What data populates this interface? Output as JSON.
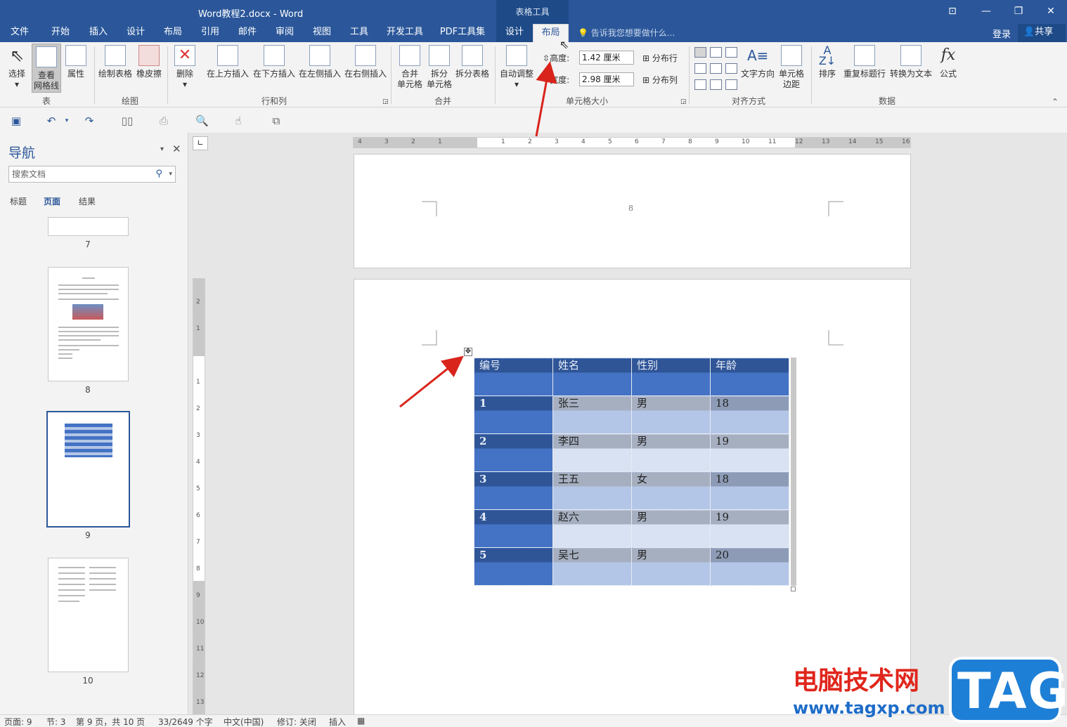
{
  "window": {
    "title": "Word教程2.docx - Word",
    "context_group": "表格工具",
    "min": "—",
    "restore": "❐",
    "close": "✕",
    "ribbon_display": "⊡"
  },
  "tabs": {
    "file": "文件",
    "home": "开始",
    "insert": "插入",
    "design": "设计",
    "layout": "布局",
    "references": "引用",
    "mailings": "邮件",
    "review": "审阅",
    "view": "视图",
    "tools": "工具",
    "developer": "开发工具",
    "pdf": "PDF工具集",
    "table_design": "设计",
    "table_layout": "布局"
  },
  "tellme": "告诉我您想要做什么...",
  "login": "登录",
  "share": "共享",
  "ribbon": {
    "select": "选择",
    "view_gridlines_1": "查看",
    "view_gridlines_2": "网格线",
    "properties": "属性",
    "draw_table": "绘制表格",
    "eraser": "橡皮擦",
    "delete": "删除",
    "insert_above": "在上方插入",
    "insert_below": "在下方插入",
    "insert_left": "在左侧插入",
    "insert_right": "在右侧插入",
    "merge_1": "合并",
    "merge_2": "单元格",
    "split_1": "拆分",
    "split_2": "单元格",
    "split_table": "拆分表格",
    "autofit": "自动调整",
    "height_label": "高度:",
    "height_value": "1.42 厘米",
    "width_label": "宽度:",
    "width_value": "2.98 厘米",
    "distribute_rows": "分布行",
    "distribute_cols": "分布列",
    "text_direction": "文字方向",
    "cell_margins_1": "单元格",
    "cell_margins_2": "边距",
    "sort": "排序",
    "repeat_header": "重复标题行",
    "convert_text": "转换为文本",
    "formula": "公式",
    "groups": {
      "table": "表",
      "draw": "绘图",
      "rows_cols": "行和列",
      "merge": "合并",
      "cell_size": "单元格大小",
      "alignment": "对齐方式",
      "data": "数据"
    }
  },
  "nav": {
    "title": "导航",
    "search_placeholder": "搜索文档",
    "tab_headings": "标题",
    "tab_pages": "页面",
    "tab_results": "结果",
    "pages": [
      "7",
      "8",
      "9",
      "10"
    ]
  },
  "ruler": {
    "h_labels": [
      "4",
      "3",
      "2",
      "1",
      "1",
      "2",
      "3",
      "4",
      "5",
      "6",
      "7",
      "8",
      "9",
      "10",
      "11",
      "12",
      "13",
      "14",
      "15",
      "16"
    ],
    "v_labels": [
      "2",
      "1",
      "1",
      "2",
      "3",
      "4",
      "5",
      "6",
      "7",
      "8",
      "9",
      "10",
      "11",
      "12",
      "13"
    ]
  },
  "document": {
    "page_number": "8",
    "table": {
      "headers": [
        "编号",
        "姓名",
        "性别",
        "年龄"
      ],
      "rows": [
        [
          "1",
          "张三",
          "男",
          "18"
        ],
        [
          "2",
          "李四",
          "男",
          "19"
        ],
        [
          "3",
          "王五",
          "女",
          "18"
        ],
        [
          "4",
          "赵六",
          "男",
          "19"
        ],
        [
          "5",
          "吴七",
          "男",
          "20"
        ]
      ]
    }
  },
  "status": {
    "page": "页面: 9",
    "section": "节: 3",
    "page_of": "第 9 页，共 10 页",
    "words": "33/2649 个字",
    "language": "中文(中国)",
    "track": "修订: 关闭",
    "insert": "插入"
  },
  "watermark": {
    "text_cn": "电脑技术网",
    "url": "www.tagxp.com",
    "tag": "TAG"
  },
  "colors": {
    "word_blue": "#2b579a",
    "header_dark": "#2f5597",
    "col1_blue": "#4472c4",
    "band_gray": "#a6afc0",
    "light_blue": "#b4c6e7",
    "arrow_red": "#d9241c"
  }
}
